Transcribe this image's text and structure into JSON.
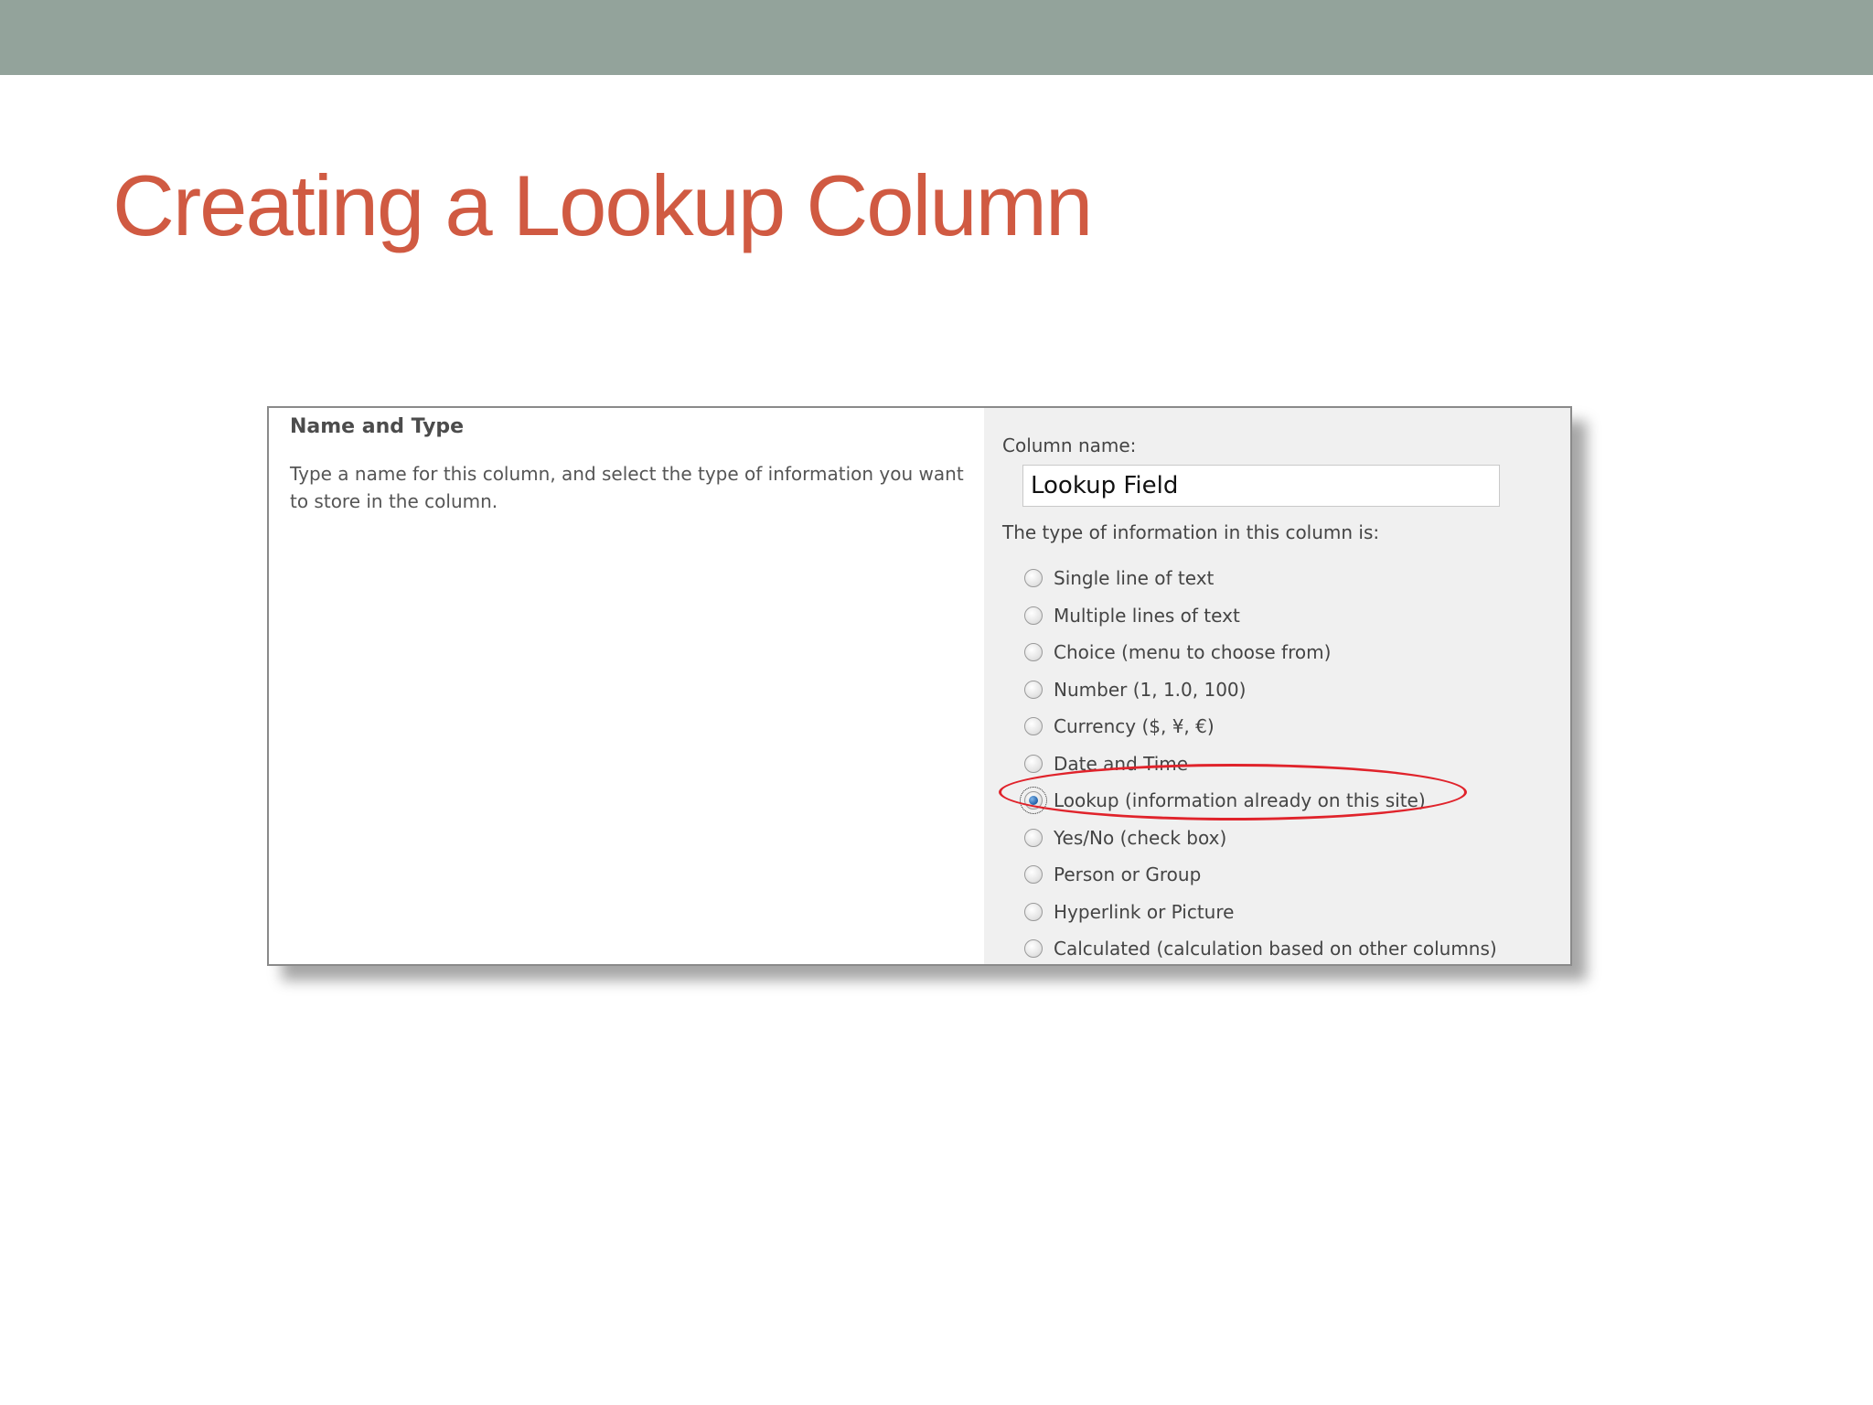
{
  "slide": {
    "title": "Creating a Lookup Column",
    "colors": {
      "top_band": "#93a39b",
      "title": "#d05a42",
      "highlight": "#e0232b"
    }
  },
  "panel": {
    "section_heading": "Name and Type",
    "section_description": "Type a name for this column, and select the type of information you want to store in the column.",
    "column_name_label": "Column name:",
    "column_name_value": "Lookup Field",
    "type_label": "The type of information in this column is:",
    "options": [
      {
        "label": "Single line of text",
        "checked": false
      },
      {
        "label": "Multiple lines of text",
        "checked": false
      },
      {
        "label": "Choice (menu to choose from)",
        "checked": false
      },
      {
        "label": "Number (1, 1.0, 100)",
        "checked": false
      },
      {
        "label": "Currency ($, ¥, €)",
        "checked": false
      },
      {
        "label": "Date and Time",
        "checked": false
      },
      {
        "label": "Lookup (information already on this site)",
        "checked": true
      },
      {
        "label": "Yes/No (check box)",
        "checked": false
      },
      {
        "label": "Person or Group",
        "checked": false
      },
      {
        "label": "Hyperlink or Picture",
        "checked": false
      },
      {
        "label": "Calculated (calculation based on other columns)",
        "checked": false
      }
    ],
    "selected_option": "Lookup (information already on this site)"
  }
}
